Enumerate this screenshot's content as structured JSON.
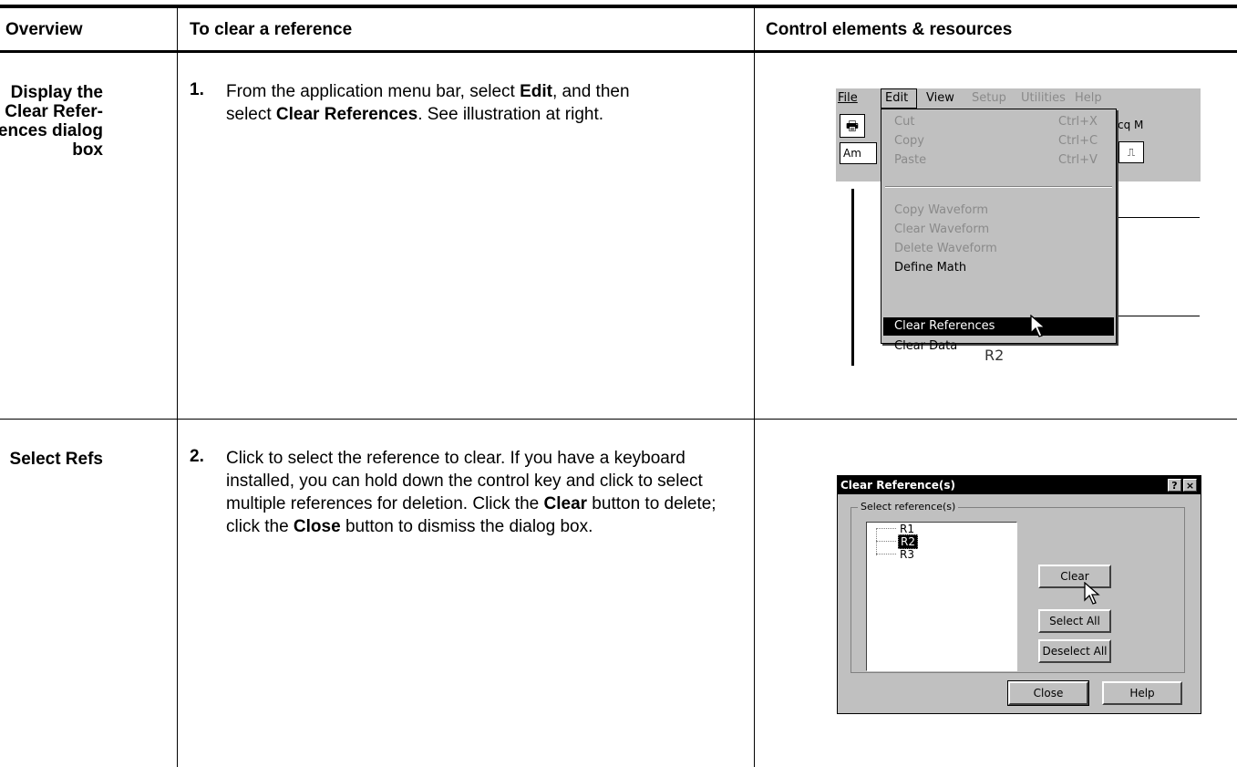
{
  "header": {
    "col1": "Overview",
    "col2": "To clear a reference",
    "col3": "Control elements & resources"
  },
  "rows": [
    {
      "overview": [
        "Display the",
        "Clear Refer-",
        "ences dialog",
        "box"
      ],
      "step_number": "1.",
      "step_text": {
        "t1": "From the application menu bar, select ",
        "b1": "Edit",
        "t2": ", and then select ",
        "b2": "Clear References",
        "t3": ". See illustration at right."
      }
    },
    {
      "overview": [
        "Select Refs"
      ],
      "step_number": "2.",
      "step_text": {
        "t1": "Click to select the reference to clear. If you have a keyboard installed, you can hold down the control key and click to select multiple references for deletion. Click the ",
        "b1": "Clear",
        "t2": " button to delete; click the ",
        "b2": "Close",
        "t3": " button to dismiss the dialog box."
      }
    }
  ],
  "menu_screenshot": {
    "menubar": [
      "File",
      "Edit",
      "View",
      "Setup",
      "Utilities",
      "Help"
    ],
    "toolbar_fragments": [
      "Am",
      "cq M",
      "⎍"
    ],
    "items": [
      {
        "label": "Cut",
        "shortcut": "Ctrl+X"
      },
      {
        "label": "Copy",
        "shortcut": "Ctrl+C"
      },
      {
        "label": "Paste",
        "shortcut": "Ctrl+V"
      },
      {
        "label": "Copy Waveform"
      },
      {
        "label": "Clear Waveform"
      },
      {
        "label": "Delete Waveform"
      },
      {
        "label": "Define Math"
      },
      {
        "label": "Clear References"
      },
      {
        "label": "Clear Data"
      }
    ],
    "waveform_label": "R2"
  },
  "dialog_screenshot": {
    "title": "Clear Reference(s)",
    "help_btn": "?",
    "close_btn": "×",
    "group_label": "Select reference(s)",
    "list": [
      "R1",
      "R2",
      "R3"
    ],
    "buttons": {
      "clear": "Clear",
      "select_all": "Select All",
      "deselect_all": "Deselect All",
      "close": "Close",
      "help": "Help"
    }
  }
}
